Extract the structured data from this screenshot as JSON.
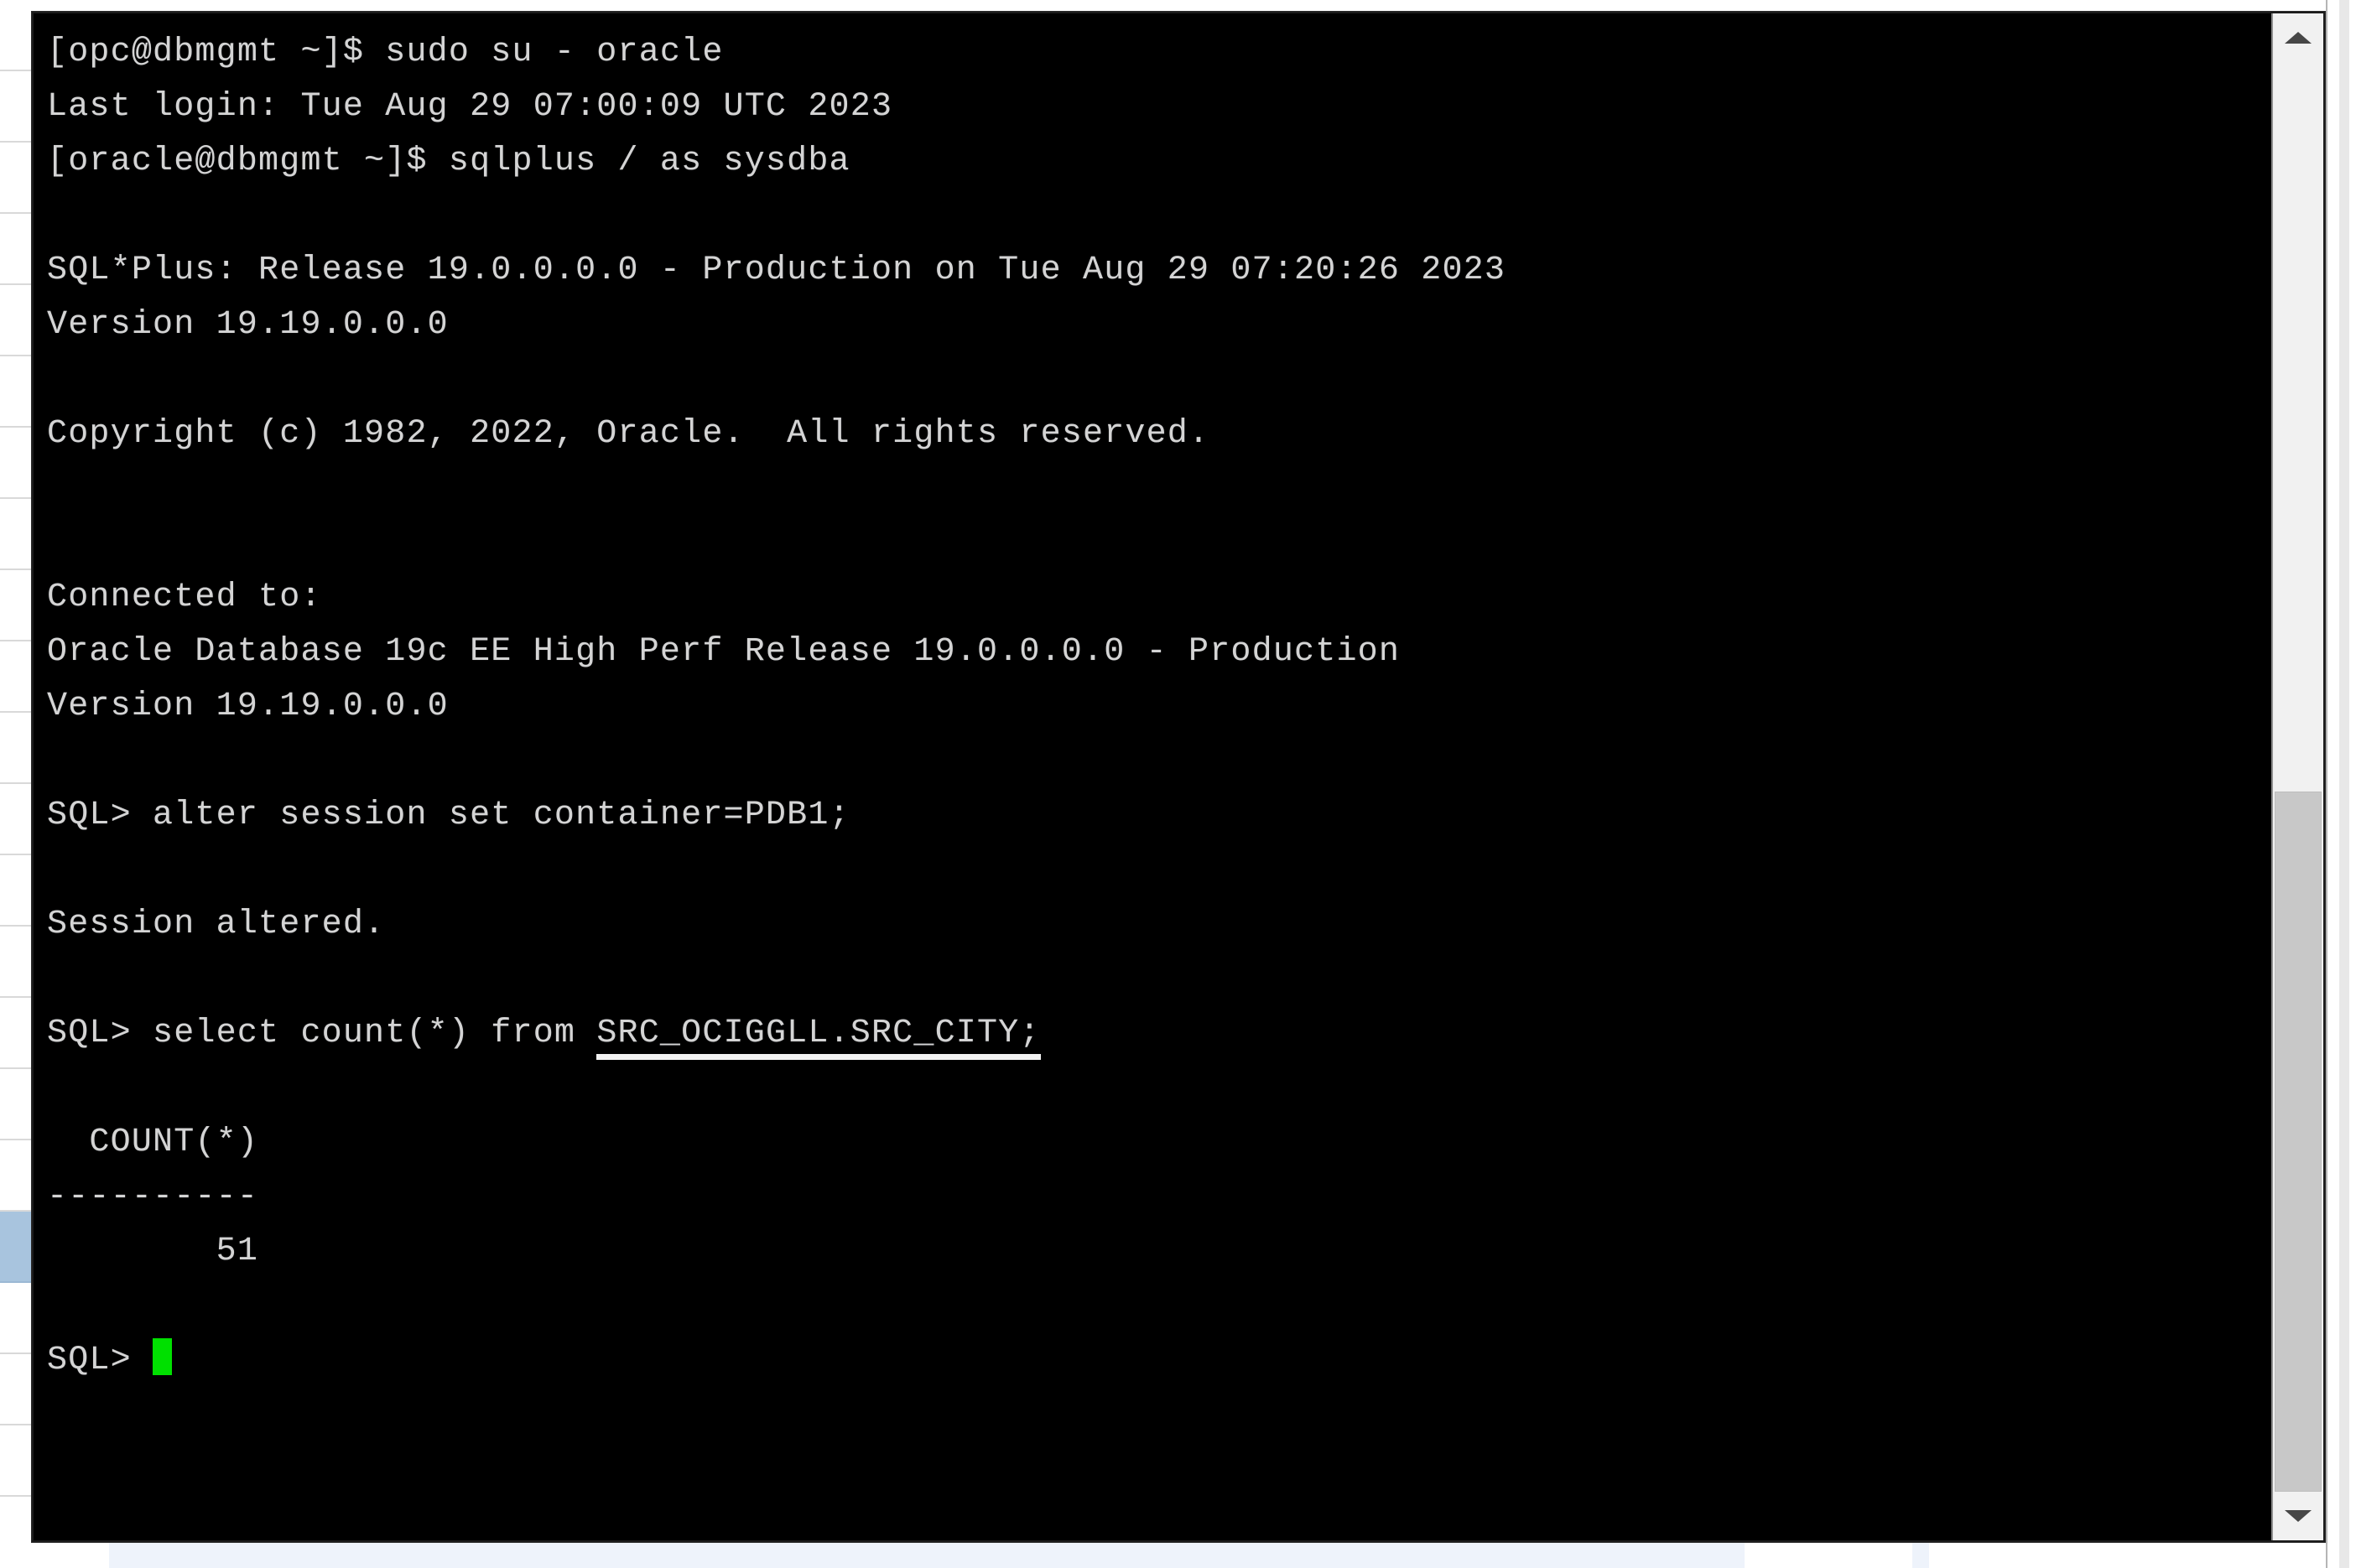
{
  "window": {
    "kind": "terminal-emulator",
    "background_color": "#000000",
    "foreground_color": "#d4d4d4",
    "cursor_color": "#00e000"
  },
  "terminal": {
    "lines": [
      {
        "id": "line-1",
        "text": "[opc@dbmgmt ~]$ sudo su - oracle"
      },
      {
        "id": "line-2",
        "text": "Last login: Tue Aug 29 07:00:09 UTC 2023"
      },
      {
        "id": "line-3",
        "text": "[oracle@dbmgmt ~]$ sqlplus / as sysdba"
      },
      {
        "id": "line-4",
        "text": ""
      },
      {
        "id": "line-5",
        "text": "SQL*Plus: Release 19.0.0.0.0 - Production on Tue Aug 29 07:20:26 2023"
      },
      {
        "id": "line-6",
        "text": "Version 19.19.0.0.0"
      },
      {
        "id": "line-7",
        "text": ""
      },
      {
        "id": "line-8",
        "text": "Copyright (c) 1982, 2022, Oracle.  All rights reserved."
      },
      {
        "id": "line-9",
        "text": ""
      },
      {
        "id": "line-10",
        "text": ""
      },
      {
        "id": "line-11",
        "text": "Connected to:"
      },
      {
        "id": "line-12",
        "text": "Oracle Database 19c EE High Perf Release 19.0.0.0.0 - Production"
      },
      {
        "id": "line-13",
        "text": "Version 19.19.0.0.0"
      },
      {
        "id": "line-14",
        "text": ""
      },
      {
        "id": "line-15",
        "text": "SQL> alter session set container=PDB1;"
      },
      {
        "id": "line-16",
        "text": ""
      },
      {
        "id": "line-17",
        "text": "Session altered."
      },
      {
        "id": "line-18",
        "text": ""
      },
      {
        "id": "line-19",
        "text": "",
        "segments": [
          {
            "text": "SQL> select count(*) from "
          },
          {
            "text": "SRC_OCIGGLL.SRC_CITY;",
            "underline": true
          }
        ]
      },
      {
        "id": "line-20",
        "text": ""
      },
      {
        "id": "line-21",
        "text": "  COUNT(*)"
      },
      {
        "id": "line-22",
        "text": "----------"
      },
      {
        "id": "line-23",
        "text": "        51"
      },
      {
        "id": "line-24",
        "text": ""
      },
      {
        "id": "line-25",
        "text": "SQL> ",
        "cursor": true
      }
    ]
  },
  "scrollbar": {
    "up_arrow": "chevron-up-icon",
    "down_arrow": "chevron-down-icon",
    "thumb_top_pct": 51,
    "thumb_height_pct": 49
  },
  "backdrop": {
    "row_count": 22,
    "selected_row_index": 17,
    "selection_color": "#a8c4de",
    "bottom_bar_color": "#eef3fb"
  }
}
